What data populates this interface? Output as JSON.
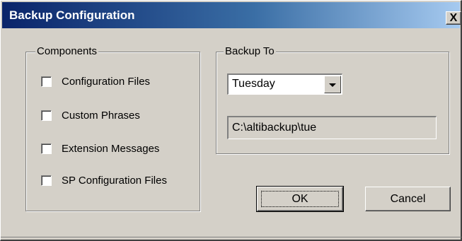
{
  "window": {
    "title": "Backup Configuration",
    "close_label": "X"
  },
  "components": {
    "legend": "Components",
    "items": [
      {
        "label": "Configuration Files",
        "checked": false
      },
      {
        "label": "Custom Phrases",
        "checked": false
      },
      {
        "label": "Extension Messages",
        "checked": false
      },
      {
        "label": "SP Configuration Files",
        "checked": false
      }
    ]
  },
  "backup_to": {
    "legend": "Backup To",
    "day_selected": "Tuesday",
    "path": "C:\\altibackup\\tue"
  },
  "buttons": {
    "ok_label": "OK",
    "cancel_label": "Cancel"
  }
}
